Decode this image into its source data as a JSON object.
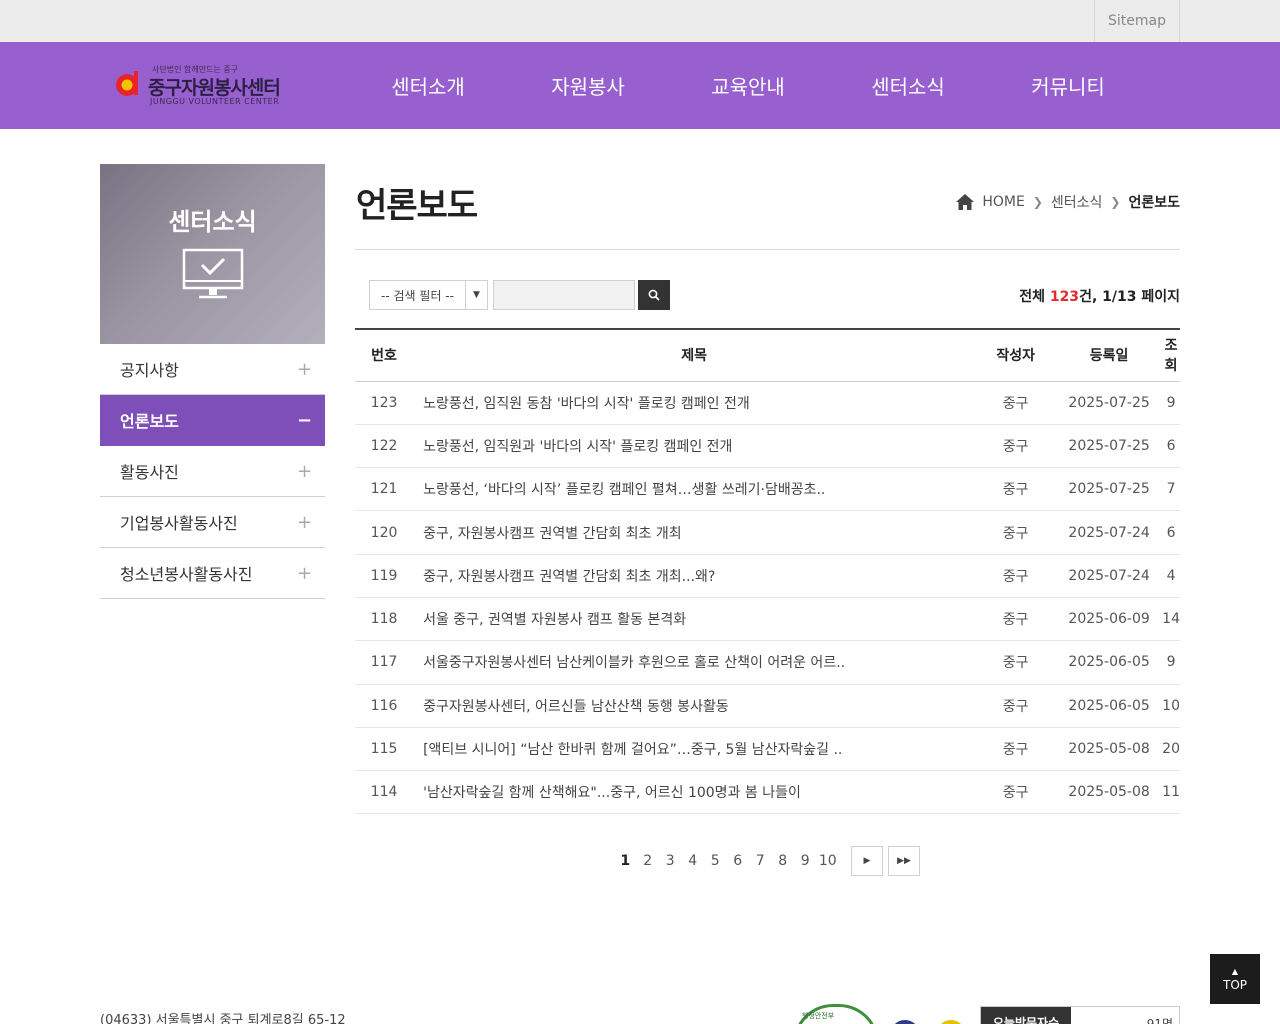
{
  "utilbar": {
    "sitemap": "Sitemap"
  },
  "logo": {
    "sub": "사단법인 함께만드는 중구",
    "main": "중구자원봉사센터",
    "en": "JUNGGU VOLUNTEER CENTER"
  },
  "gnb": [
    "센터소개",
    "자원봉사",
    "교육안내",
    "센터소식",
    "커뮤니티"
  ],
  "lnb": {
    "title": "센터소식",
    "items": [
      {
        "label": "공지사항",
        "sign": "+"
      },
      {
        "label": "언론보도",
        "sign": "−"
      },
      {
        "label": "활동사진",
        "sign": "+"
      },
      {
        "label": "기업봉사활동사진",
        "sign": "+"
      },
      {
        "label": "청소년봉사활동사진",
        "sign": "+"
      }
    ]
  },
  "page": {
    "title": "언론보도",
    "breadcrumb": [
      "HOME",
      "센터소식",
      "언론보도"
    ]
  },
  "search": {
    "filter_label": "-- 검색 필터 --",
    "input_value": ""
  },
  "summary": {
    "prefix": "전체 ",
    "count": "123",
    "suffix": "건, 1/13 페이지"
  },
  "table": {
    "headers": [
      "번호",
      "제목",
      "작성자",
      "등록일",
      "조회"
    ],
    "rows": [
      [
        "123",
        "노랑풍선, 임직원 동참 '바다의 시작' 플로킹 캠페인 전개",
        "중구",
        "2025-07-25",
        "9"
      ],
      [
        "122",
        "노랑풍선, 임직원과 '바다의 시작' 플로킹 캠페인 전개",
        "중구",
        "2025-07-25",
        "6"
      ],
      [
        "121",
        "노랑풍선, ‘바다의 시작’ 플로킹 캠페인 펼쳐…생활 쓰레기·담배꽁초..",
        "중구",
        "2025-07-25",
        "7"
      ],
      [
        "120",
        "중구, 자원봉사캠프 권역별 간담회 최초 개최",
        "중구",
        "2025-07-24",
        "6"
      ],
      [
        "119",
        "중구, 자원봉사캠프 권역별 간담회 최초 개최...왜?",
        "중구",
        "2025-07-24",
        "4"
      ],
      [
        "118",
        "서울 중구, 권역별 자원봉사 캠프 활동 본격화",
        "중구",
        "2025-06-09",
        "14"
      ],
      [
        "117",
        "서울중구자원봉사센터 남산케이블카 후원으로 홀로 산책이 어려운 어르..",
        "중구",
        "2025-06-05",
        "9"
      ],
      [
        "116",
        "중구자원봉사센터, 어르신들 남산산책 동행 봉사활동",
        "중구",
        "2025-06-05",
        "10"
      ],
      [
        "115",
        "[액티브 시니어] “남산 한바퀴 함께 걸어요”…중구, 5월 남산자락숲길 ..",
        "중구",
        "2025-05-08",
        "20"
      ],
      [
        "114",
        "'남산자락숲길 함께 산책해요\"...중구, 어르신 100명과 봄 나들이",
        "중구",
        "2025-05-08",
        "11"
      ]
    ]
  },
  "pagination": {
    "pages": [
      "1",
      "2",
      "3",
      "4",
      "5",
      "6",
      "7",
      "8",
      "9",
      "10"
    ],
    "current": "1"
  },
  "top_button": "TOP",
  "footer": {
    "address": "(04633) 서울특별시 중구 퇴계로8길 65-12",
    "badge_text": "행정안전부",
    "visitor_label": "오늘방문자수",
    "visitor_count": "91명"
  },
  "colors": {
    "header_bg": "#9860cf",
    "lnb_active": "#7e4fb8",
    "count_red": "#e52a2a"
  }
}
